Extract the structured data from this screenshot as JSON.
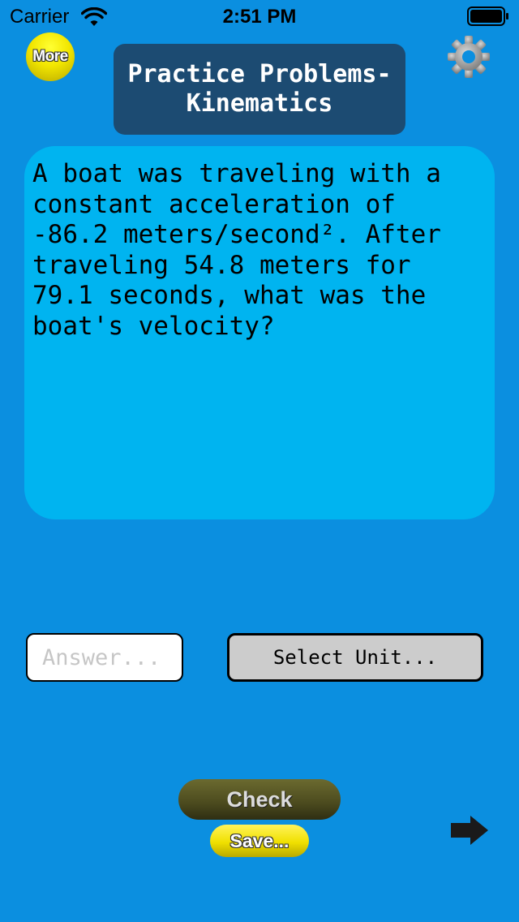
{
  "status_bar": {
    "carrier": "Carrier",
    "time": "2:51 PM",
    "icons": [
      "wifi-icon",
      "battery-icon"
    ]
  },
  "header": {
    "more_label": "More",
    "title": "Practice Problems-\nKinematics",
    "settings_icon": "gear-icon"
  },
  "question": {
    "text": "A boat was traveling with a\nconstant acceleration of\n-86.2 meters/second². After\ntraveling 54.8 meters for\n79.1 seconds, what was the\nboat's velocity?"
  },
  "answer": {
    "value": "",
    "placeholder": "Answer...",
    "unit_label": "Select Unit..."
  },
  "actions": {
    "check_label": "Check",
    "save_label": "Save...",
    "next_icon": "right-arrow-icon"
  },
  "colors": {
    "background": "#0b8fe0",
    "title_box": "#1c4b72",
    "question_card": "#00b4f0",
    "unit_button": "#cccccc",
    "more_button": "#f2e600",
    "check_button": "#4b4a1e"
  }
}
